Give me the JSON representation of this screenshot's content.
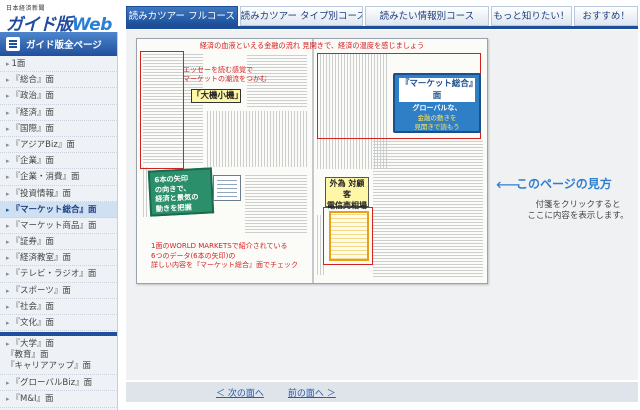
{
  "logo": {
    "small": "日本経済新聞",
    "main": "ガイド版",
    "web": "Web"
  },
  "tabs": [
    {
      "label": "読みカツアー フルコース",
      "active": true
    },
    {
      "label": "読みカツアー タイプ別コース"
    },
    {
      "label": "読みたい情報別コース"
    },
    {
      "label": "もっと知りたい！"
    },
    {
      "label": "おすすめ！"
    }
  ],
  "sidebar": {
    "heading": "ガイド版全ページ",
    "items": [
      "1面",
      "『総合』面",
      "『政治』面",
      "『経済』面",
      "『国際』面",
      "『アジアBiz』面",
      "『企業』面",
      "『企業・消費』面",
      "『投資情報』面",
      "『マーケット総合』面",
      "『マーケット商品』面",
      "『証券』面",
      "『経済教室』面",
      "『テレビ・ラジオ』面",
      "『スポーツ』面",
      "『社会』面",
      "『文化』面"
    ],
    "active_index": 9,
    "items2_multi": "『大学』面\n『教育』面\n『キャリアアップ』面",
    "items2": [
      "『グローバルBiz』面",
      "『M&I』面"
    ]
  },
  "paper": {
    "caption_top": "経済の血液といえる金融の流れ 見開きで、経済の温度を感じましょう",
    "ann1_line1": "エッセーを読む感覚で",
    "ann1_line2": "マーケットの潮流をつかむ",
    "column_name": "「大機小機」",
    "market_title": "『マーケット総合』面",
    "market_sub1": "グローバルな、",
    "market_sub2": "金融の動きを",
    "market_sub3": "見開きで読もう",
    "gaitame_line1": "外為 対顧客",
    "gaitame_line2": "電信売相場",
    "green_line1": "6本の矢印",
    "green_line2": "の向きで、",
    "green_line3": "経済と景気の",
    "green_line4": "動きを把握",
    "ann_bottom_line1": "1面のWORLD MARKETSで紹介されている",
    "ann_bottom_line2": "6つのデータ(6本の矢印)の",
    "ann_bottom_line3": "詳しい内容を『マーケット総合』面でチェック"
  },
  "help": {
    "title": "このページの見方",
    "desc_line1": "付箋をクリックすると",
    "desc_line2": "ここに内容を表示します。"
  },
  "nav": {
    "next": "次の面へ",
    "prev": "前の面へ",
    "next_arrow": "＜",
    "prev_arrow": "＞"
  }
}
